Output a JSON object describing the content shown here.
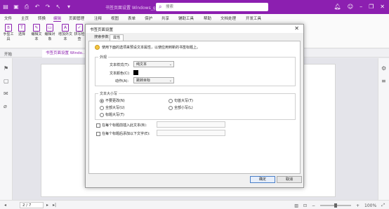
{
  "titlebar": {
    "doc_title": "书签页面设置 Windows_guide",
    "search_placeholder": "搜索",
    "quick_icons": [
      "folder-icon",
      "save-icon",
      "print-icon",
      "undo-icon",
      "redo-icon",
      "cursor-icon",
      "dropdown-icon"
    ],
    "right_icons": [
      "bell-icon",
      "user-icon",
      "minimize-icon",
      "restore-icon",
      "close-icon"
    ]
  },
  "menu": [
    "文件",
    "主页",
    "转换",
    "编辑",
    "页面管理",
    "注释",
    "视图",
    "表单",
    "保护",
    "共享",
    "辅助工具",
    "帮助",
    "文档处理",
    "开发工具"
  ],
  "active_menu": "编辑",
  "tools": [
    {
      "label": "手型工具",
      "icon": "hand-icon"
    },
    {
      "label": "选择",
      "icon": "select-icon"
    },
    {
      "label": "编辑文本",
      "icon": "edit-text-icon"
    },
    {
      "label": "编辑对象",
      "icon": "edit-object-icon"
    },
    {
      "label": "增加外文本",
      "icon": "add-text-icon"
    },
    {
      "label": "拼写检查",
      "icon": "spellcheck-icon"
    }
  ],
  "tabs": {
    "start": "开始",
    "doc": "书签页面设置 Windo..."
  },
  "dialog": {
    "title": "书签页面设置",
    "tab1": "搜索参数",
    "tab2": "属性",
    "tip": "使用下面的选项来预设文本属性，以使应用到新的书签标题上。",
    "appearance_group": "外观",
    "font_style_label": "文本样式(T):",
    "font_style_value": "纯文本",
    "text_color_label": "文本颜色(C):",
    "text_color": "#000000",
    "action_label": "动作(A):",
    "action_value": "跳转目标",
    "case_group": "文本大小写",
    "radio_options": [
      "不要更改(N)",
      "全部大写(U)",
      "标题大写(T)",
      "句首大写(T)",
      "全部小写(L)"
    ],
    "radio_selected": 0,
    "check1": "在每个标题前插入此文本(B):",
    "check2": "在每个标题后添加以下文字(E):",
    "ok": "确定",
    "cancel": "取消"
  },
  "statusbar": {
    "page": "2 / 7",
    "zoom": "100%"
  }
}
